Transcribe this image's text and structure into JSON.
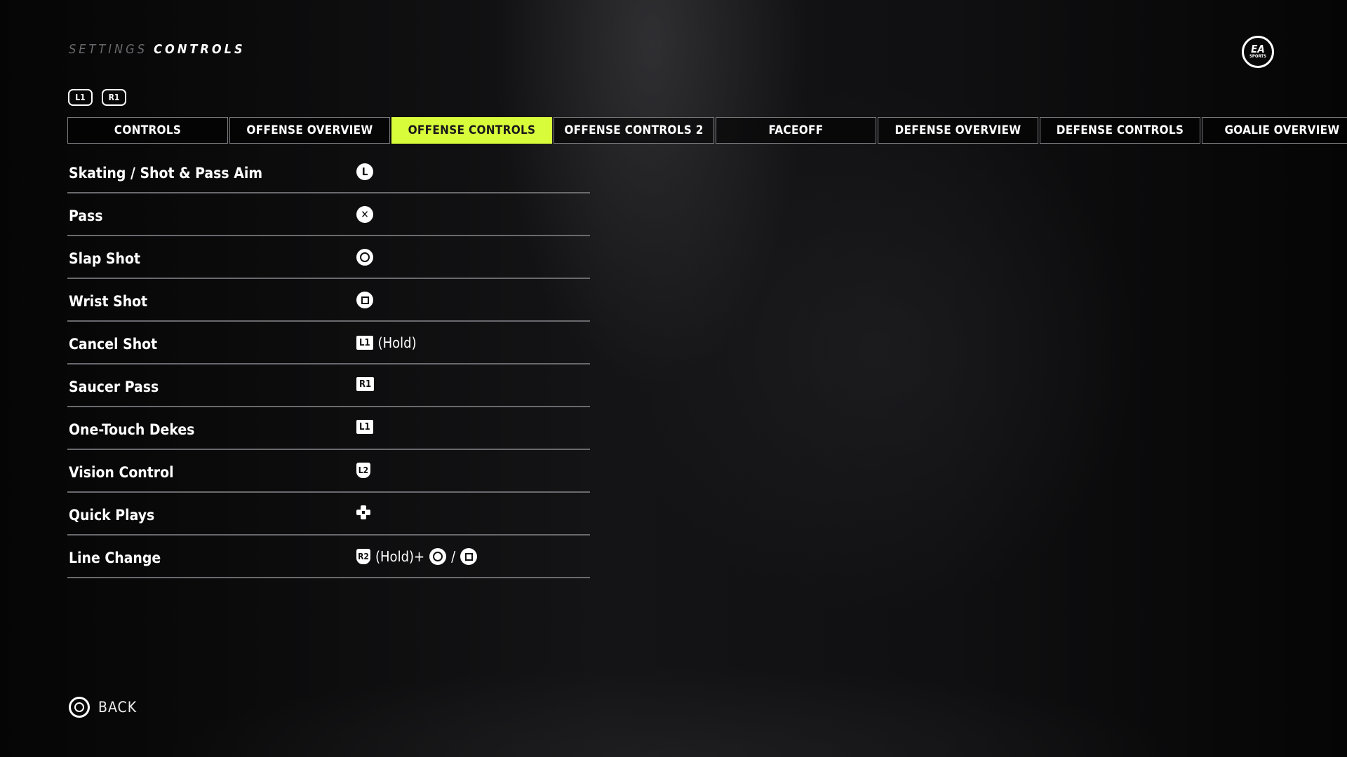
{
  "header": {
    "breadcrumb_parent": "SETTINGS",
    "breadcrumb_current": "CONTROLS",
    "bumper_left": "L1",
    "bumper_right": "R1",
    "logo_top": "EA",
    "logo_bottom": "SPORTS"
  },
  "tabs": [
    {
      "label": "CONTROLS",
      "active": false
    },
    {
      "label": "OFFENSE OVERVIEW",
      "active": false
    },
    {
      "label": "OFFENSE CONTROLS",
      "active": true
    },
    {
      "label": "OFFENSE CONTROLS 2",
      "active": false
    },
    {
      "label": "FACEOFF",
      "active": false
    },
    {
      "label": "DEFENSE OVERVIEW",
      "active": false
    },
    {
      "label": "DEFENSE CONTROLS",
      "active": false
    },
    {
      "label": "GOALIE OVERVIEW",
      "active": false
    }
  ],
  "accent_color": "#D8FC3A",
  "rows": [
    {
      "action": "Skating / Shot & Pass Aim",
      "icon": "left-stick-icon",
      "glyph": "L"
    },
    {
      "action": "Pass",
      "icon": "cross-button-icon",
      "glyph": "✕"
    },
    {
      "action": "Slap Shot",
      "icon": "circle-button-icon"
    },
    {
      "action": "Wrist Shot",
      "icon": "square-button-icon"
    },
    {
      "action": "Cancel Shot",
      "icon": "l1-button-icon",
      "glyph": "L1",
      "suffix": "(Hold)"
    },
    {
      "action": "Saucer Pass",
      "icon": "r1-button-icon",
      "glyph": "R1"
    },
    {
      "action": "One-Touch Dekes",
      "icon": "l1-button-icon",
      "glyph": "L1"
    },
    {
      "action": "Vision Control",
      "icon": "l2-trigger-icon",
      "glyph": "L2"
    },
    {
      "action": "Quick Plays",
      "icon": "dpad-icon"
    },
    {
      "action": "Line Change",
      "icon": "r2-trigger-icon",
      "glyph": "R2",
      "suffix": "(Hold)+",
      "separator": "/"
    }
  ],
  "footer": {
    "back_label": "BACK",
    "back_icon": "circle-button-icon"
  }
}
